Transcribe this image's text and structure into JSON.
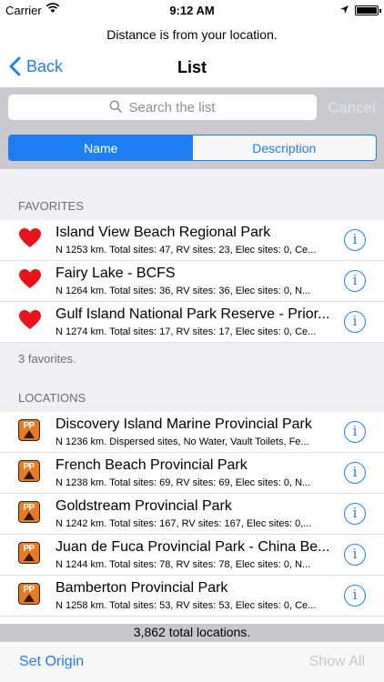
{
  "status_bar": {
    "carrier": "Carrier",
    "time": "9:12 AM"
  },
  "prompt": "Distance is from your location.",
  "navbar": {
    "back_label": "Back",
    "title": "List"
  },
  "search": {
    "placeholder": "Search the list",
    "cancel_label": "Cancel"
  },
  "segments": {
    "name_label": "Name",
    "description_label": "Description",
    "selected": "Name"
  },
  "favorites": {
    "header": "FAVORITES",
    "footer": "3 favorites.",
    "items": [
      {
        "name": "Island View Beach Regional Park",
        "detail": "N 1253 km. Total sites: 47, RV sites: 23, Elec sites: 0, Ce..."
      },
      {
        "name": "Fairy Lake - BCFS",
        "detail": "N 1264 km. Total sites: 36, RV sites: 36, Elec sites: 0, N..."
      },
      {
        "name": "Gulf Island National Park Reserve - Prior...",
        "detail": "N 1274 km. Total sites: 17, RV sites: 17, Elec sites: 0, Ce..."
      }
    ]
  },
  "locations": {
    "header": "LOCATIONS",
    "items": [
      {
        "name": "Discovery Island Marine Provincial Park",
        "detail": "N 1236 km. Dispersed sites, No Water, Vault Toilets, Fe..."
      },
      {
        "name": "French Beach Provincial Park",
        "detail": "N 1238 km. Total sites: 69, RV sites: 69, Elec sites: 0, N..."
      },
      {
        "name": "Goldstream Provincial Park",
        "detail": "N 1242 km. Total sites: 167, RV sites: 167, Elec sites: 0,..."
      },
      {
        "name": "Juan de Fuca Provincial Park - China Be...",
        "detail": "N 1244 km. Total sites: 78, RV sites: 78, Elec sites: 0, N..."
      },
      {
        "name": "Bamberton Provincial Park",
        "detail": "N 1258 km. Total sites: 53, RV sites: 53, Elec sites: 0, Ce..."
      }
    ]
  },
  "icons": {
    "favorite": "heart-icon",
    "location": "provincial-park-icon",
    "info": "info-icon",
    "search": "search-icon",
    "back": "chevron-left-icon"
  },
  "colors": {
    "accent": "#1e7ef1",
    "heart": "#e8141c",
    "park_badge": "#e87a22"
  },
  "footer": {
    "total_text": "3,862 total locations.",
    "set_origin_label": "Set Origin",
    "show_all_label": "Show All"
  }
}
